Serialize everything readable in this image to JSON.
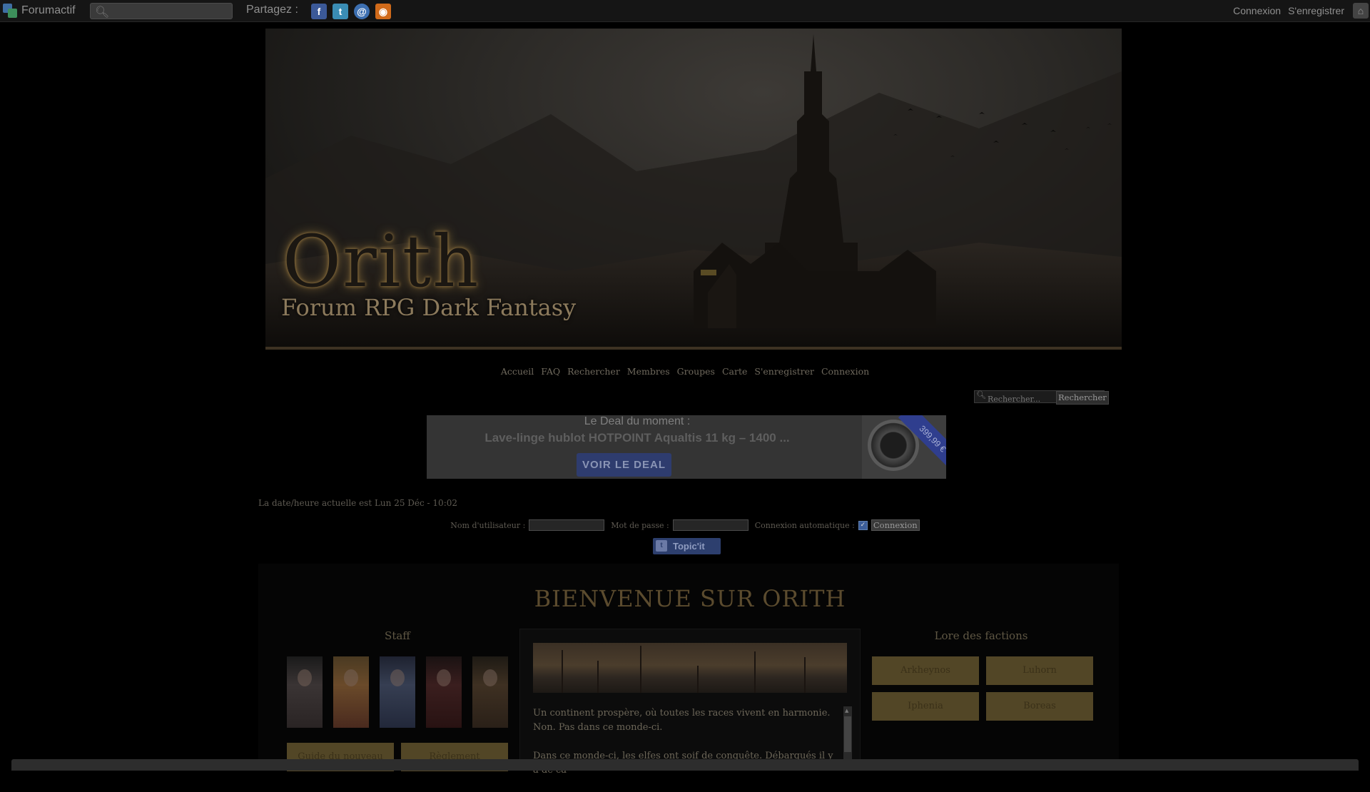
{
  "topbar": {
    "brand": "Forumactif",
    "share_label": "Partagez :",
    "share_icons": [
      "facebook-icon",
      "twitter-icon",
      "email-icon",
      "rss-icon"
    ],
    "share_glyphs": {
      "facebook": "f",
      "twitter": "t",
      "email": "@",
      "rss": "◉"
    },
    "login": "Connexion",
    "register": "S'enregistrer"
  },
  "banner": {
    "title": "Orith",
    "subtitle": "Forum RPG Dark Fantasy"
  },
  "nav": [
    "Accueil",
    "FAQ",
    "Rechercher",
    "Membres",
    "Groupes",
    "Carte",
    "S'enregistrer",
    "Connexion"
  ],
  "forum_search": {
    "placeholder": "Rechercher...",
    "button": "Rechercher"
  },
  "deal": {
    "label": "Le Deal du moment :",
    "product": "Lave-linge hublot HOTPOINT Aqualtis 11 kg – 1400 ...",
    "button": "VOIR LE DEAL",
    "price": "399,99 €"
  },
  "datetime": "La date/heure actuelle est Lun 25 Déc - 10:02",
  "login_form": {
    "username_label": "Nom d'utilisateur :",
    "password_label": "Mot de passe :",
    "auto_label": "Connexion automatique :",
    "submit": "Connexion"
  },
  "topicit": "Topic'it",
  "welcome": "BIENVENUE SUR ORITH",
  "staff": {
    "title": "Staff",
    "buttons": [
      "Guide du nouveau",
      "Règlement"
    ]
  },
  "lore": {
    "title": "Lore des factions",
    "factions": [
      "Arkheynos",
      "Luhorn",
      "Iphenia",
      "Boreas"
    ]
  },
  "intro": {
    "p1": "Un continent prospère, où toutes les races vivent en harmonie. Non. Pas dans ce monde-ci.",
    "p2": "Dans ce monde-ci, les elfes ont soif de conquête. Débarqués il y a de ca"
  },
  "colors": {
    "topbar_bg": "#151515",
    "accent_gold": "#5b4b2e",
    "button_gold": "#524626",
    "deal_blue": "#2e3c6e"
  }
}
